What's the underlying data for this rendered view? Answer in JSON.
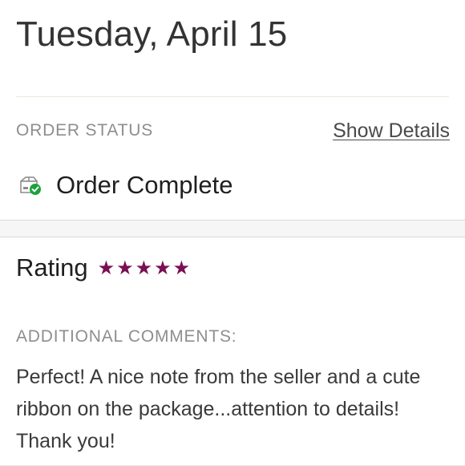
{
  "header": {
    "date": "Tuesday, April 15"
  },
  "order_status": {
    "label": "ORDER STATUS",
    "show_details_label": "Show Details",
    "status_text": "Order Complete",
    "status_icon": "box-check-icon",
    "status_color": "#1aa33a"
  },
  "rating": {
    "label": "Rating",
    "stars": 5,
    "max_stars": 5,
    "star_icon": "star-icon",
    "star_color": "#7a0f52"
  },
  "comments": {
    "label": "ADDITIONAL COMMENTS:",
    "text": "Perfect! A nice note from the seller and a cute ribbon on the package...attention to details! Thank you!"
  }
}
